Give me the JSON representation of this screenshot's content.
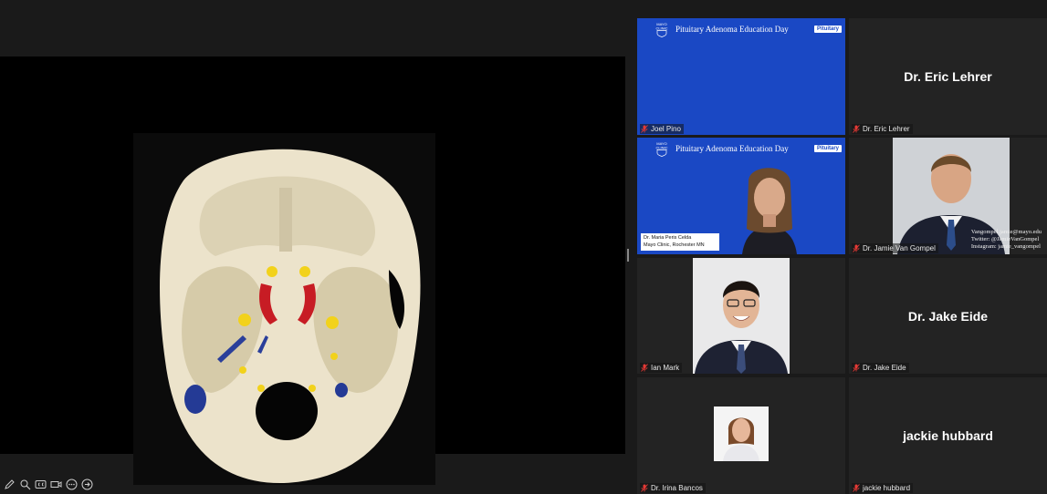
{
  "share": {
    "toolbar_icons": [
      "pencil-icon",
      "zoom-icon",
      "closed-caption-icon",
      "video-icon",
      "more-icon",
      "arrow-right-icon"
    ]
  },
  "branding": {
    "logo_line1": "MAYO",
    "logo_line2": "CLINIC",
    "event_title": "Pituitary Adenoma Education Day",
    "badge": "Pituitary"
  },
  "tiles": [
    {
      "id": "joel-pino",
      "label": "Joel Pino",
      "mic_muted": true
    },
    {
      "id": "eric-lehrer",
      "label": "Dr. Eric Lehrer",
      "display_name": "Dr. Eric Lehrer",
      "mic_muted": true
    },
    {
      "id": "maria-peris-celda",
      "caption_line1": "Dr. Maria Peris Celda",
      "caption_line2": "Mayo Clinic, Rochester MN",
      "active_speaker": true
    },
    {
      "id": "jamie-van-gompel",
      "label": "Dr. Jamie Van Gompel",
      "social_line1": "Vangompel.jamie@mayo.edu",
      "social_line2": "Twitter: @JamieVanGompel",
      "social_line3": "Instagram: jamie_vangompel",
      "mic_muted": true
    },
    {
      "id": "ian-mark",
      "label": "Ian Mark",
      "mic_muted": true
    },
    {
      "id": "jake-eide",
      "label": "Dr. Jake Eide",
      "display_name": "Dr. Jake Eide",
      "mic_muted": true
    },
    {
      "id": "irina-bancos",
      "label": "Dr. Irina Bancos",
      "mic_muted": true
    },
    {
      "id": "jackie-hubbard",
      "label": "jackie hubbard",
      "display_name": "jackie hubbard",
      "mic_muted": true
    }
  ],
  "colors": {
    "muted_mic": "#e53935",
    "active_border": "#9acd32",
    "brand_blue": "#1a48c4"
  }
}
